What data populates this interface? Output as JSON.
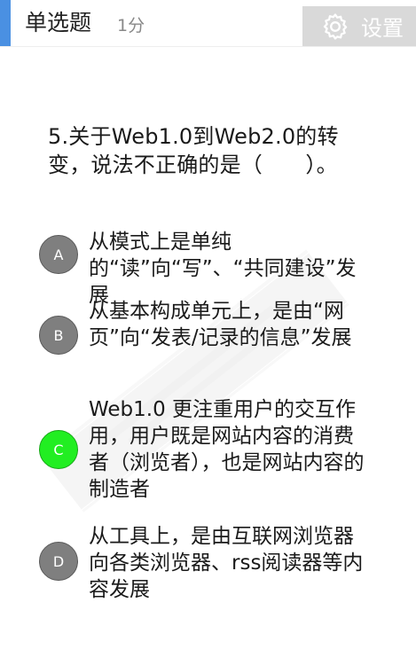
{
  "header": {
    "question_type": "单选题",
    "score": "1分",
    "settings_label": "设置",
    "settings_icon": "gear-icon",
    "accent_color": "#4a90e2"
  },
  "question": {
    "text": "5.关于Web1.0到Web2.0的转变，说法不正确的是（　　）。"
  },
  "options": [
    {
      "letter": "A",
      "text": "从模式上是单纯的“读”向“写”、“共同建设”发展",
      "selected": false
    },
    {
      "letter": "B",
      "text": "从基本构成单元上，是由“网页”向“发表/记录的信息”发展",
      "selected": false
    },
    {
      "letter": "C",
      "text": "Web1.0 更注重用户的交互作用，用户既是网站内容的消费者（浏览者），也是网站内容的制造者",
      "selected": true
    },
    {
      "letter": "D",
      "text": "从工具上，是由互联网浏览器向各类浏览器、rss阅读器等内容发展",
      "selected": false
    }
  ],
  "colors": {
    "option_default": "#7f7f7f",
    "option_selected": "#22ee22"
  }
}
